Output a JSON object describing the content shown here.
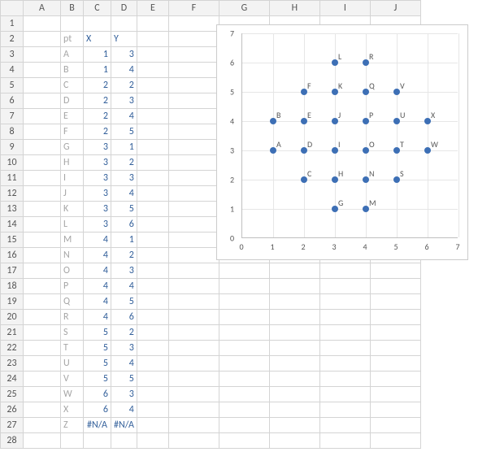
{
  "columns": [
    "A",
    "B",
    "C",
    "D",
    "E",
    "F",
    "G",
    "H",
    "I",
    "J"
  ],
  "table": {
    "header": {
      "pt": "pt",
      "x": "X",
      "y": "Y"
    },
    "rows": [
      {
        "label": "A",
        "x": "1",
        "y": "3"
      },
      {
        "label": "B",
        "x": "1",
        "y": "4"
      },
      {
        "label": "C",
        "x": "2",
        "y": "2"
      },
      {
        "label": "D",
        "x": "2",
        "y": "3"
      },
      {
        "label": "E",
        "x": "2",
        "y": "4"
      },
      {
        "label": "F",
        "x": "2",
        "y": "5"
      },
      {
        "label": "G",
        "x": "3",
        "y": "1"
      },
      {
        "label": "H",
        "x": "3",
        "y": "2"
      },
      {
        "label": "I",
        "x": "3",
        "y": "3"
      },
      {
        "label": "J",
        "x": "3",
        "y": "4"
      },
      {
        "label": "K",
        "x": "3",
        "y": "5"
      },
      {
        "label": "L",
        "x": "3",
        "y": "6"
      },
      {
        "label": "M",
        "x": "4",
        "y": "1"
      },
      {
        "label": "N",
        "x": "4",
        "y": "2"
      },
      {
        "label": "O",
        "x": "4",
        "y": "3"
      },
      {
        "label": "P",
        "x": "4",
        "y": "4"
      },
      {
        "label": "Q",
        "x": "4",
        "y": "5"
      },
      {
        "label": "R",
        "x": "4",
        "y": "6"
      },
      {
        "label": "S",
        "x": "5",
        "y": "2"
      },
      {
        "label": "T",
        "x": "5",
        "y": "3"
      },
      {
        "label": "U",
        "x": "5",
        "y": "4"
      },
      {
        "label": "V",
        "x": "5",
        "y": "5"
      },
      {
        "label": "W",
        "x": "6",
        "y": "3"
      },
      {
        "label": "X",
        "x": "6",
        "y": "4"
      },
      {
        "label": "Z",
        "x": "#N/A",
        "y": "#N/A"
      }
    ]
  },
  "chart_data": {
    "type": "scatter",
    "xlim": [
      0,
      7
    ],
    "ylim": [
      0,
      7
    ],
    "xticks": [
      0,
      1,
      2,
      3,
      4,
      5,
      6,
      7
    ],
    "yticks": [
      0,
      1,
      2,
      3,
      4,
      5,
      6,
      7
    ],
    "points": [
      {
        "name": "A",
        "x": 1,
        "y": 3
      },
      {
        "name": "B",
        "x": 1,
        "y": 4
      },
      {
        "name": "C",
        "x": 2,
        "y": 2
      },
      {
        "name": "D",
        "x": 2,
        "y": 3
      },
      {
        "name": "E",
        "x": 2,
        "y": 4
      },
      {
        "name": "F",
        "x": 2,
        "y": 5
      },
      {
        "name": "G",
        "x": 3,
        "y": 1
      },
      {
        "name": "H",
        "x": 3,
        "y": 2
      },
      {
        "name": "I",
        "x": 3,
        "y": 3
      },
      {
        "name": "J",
        "x": 3,
        "y": 4
      },
      {
        "name": "K",
        "x": 3,
        "y": 5
      },
      {
        "name": "L",
        "x": 3,
        "y": 6
      },
      {
        "name": "M",
        "x": 4,
        "y": 1
      },
      {
        "name": "N",
        "x": 4,
        "y": 2
      },
      {
        "name": "O",
        "x": 4,
        "y": 3
      },
      {
        "name": "P",
        "x": 4,
        "y": 4
      },
      {
        "name": "Q",
        "x": 4,
        "y": 5
      },
      {
        "name": "R",
        "x": 4,
        "y": 6
      },
      {
        "name": "S",
        "x": 5,
        "y": 2
      },
      {
        "name": "T",
        "x": 5,
        "y": 3
      },
      {
        "name": "U",
        "x": 5,
        "y": 4
      },
      {
        "name": "V",
        "x": 5,
        "y": 5
      },
      {
        "name": "W",
        "x": 6,
        "y": 3
      },
      {
        "name": "X",
        "x": 6,
        "y": 4
      }
    ]
  }
}
